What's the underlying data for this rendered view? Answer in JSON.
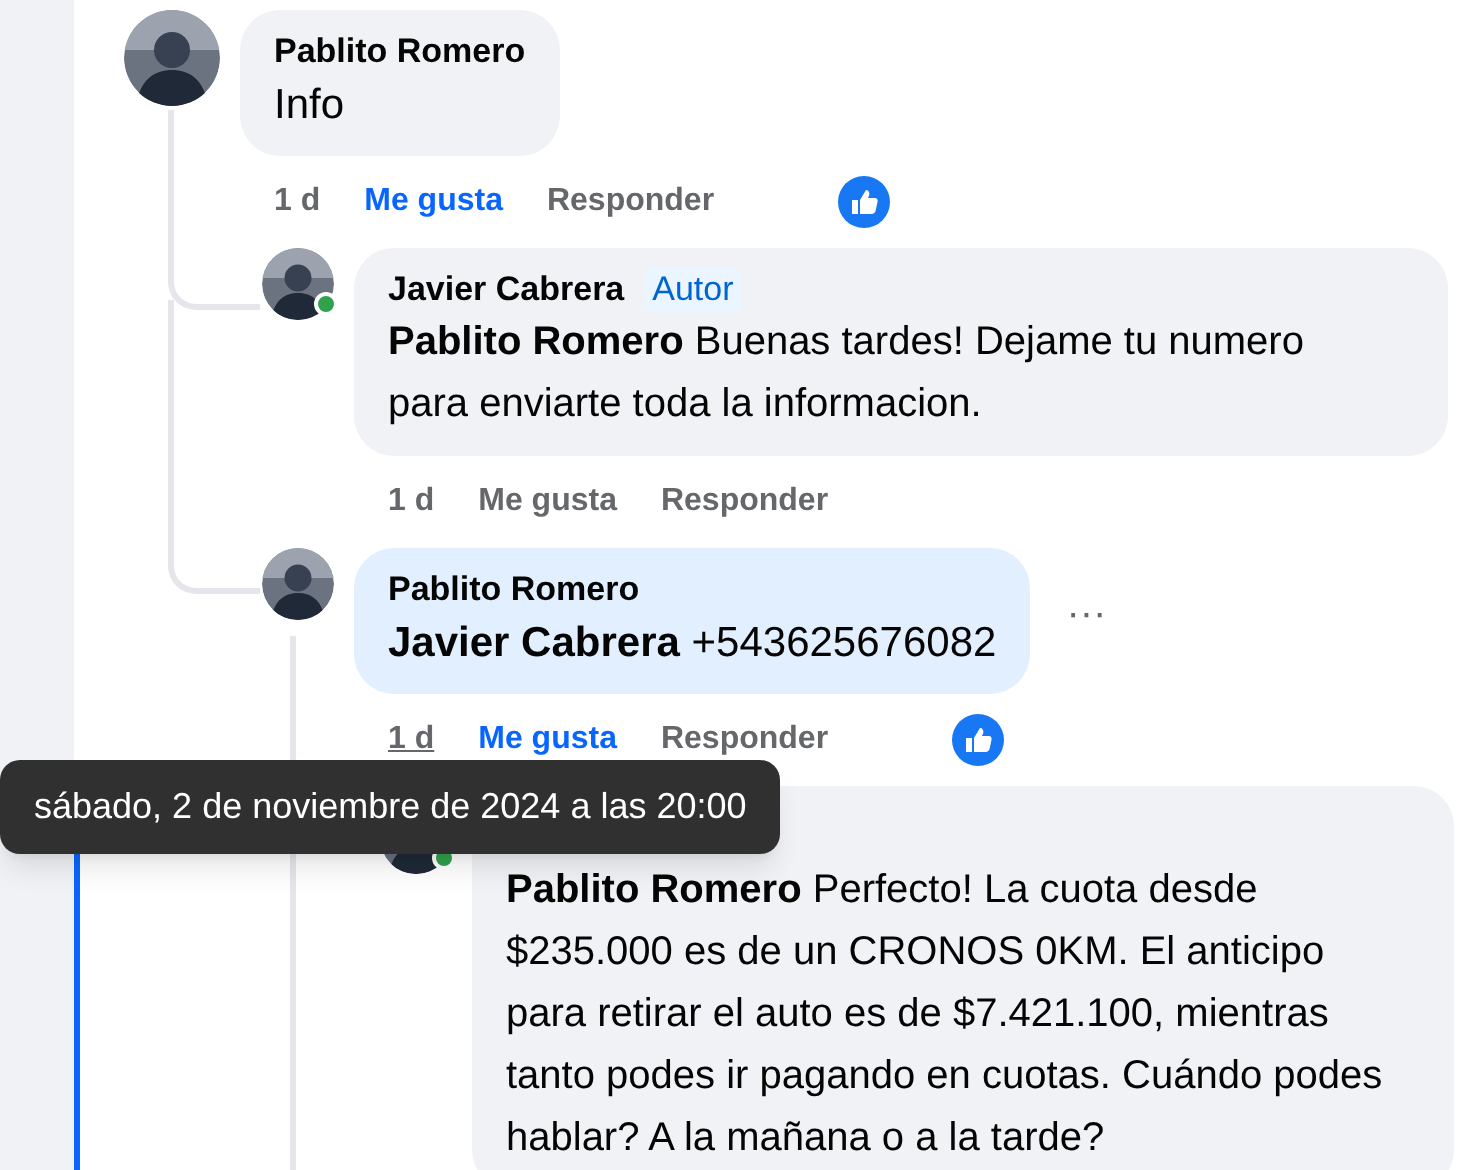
{
  "comments": [
    {
      "author": "Pablito Romero",
      "text": "Info",
      "highlighted": false,
      "online": false,
      "time": "1 d",
      "time_hovered": false,
      "like_label": "Me gusta",
      "liked": true,
      "reply_label": "Responder",
      "reaction": true,
      "replies": [
        {
          "author": "Javier Cabrera",
          "badge": "Autor",
          "text": "**Pablito Romero** Buenas tardes! Dejame tu numero para enviarte toda la informacion.",
          "highlighted": false,
          "online": true,
          "time": "1 d",
          "time_hovered": false,
          "like_label": "Me gusta",
          "liked": false,
          "reply_label": "Responder",
          "reaction": false
        },
        {
          "author": "Pablito Romero",
          "text": "**Javier Cabrera** +543625676082",
          "highlighted": true,
          "online": false,
          "more_label": "···",
          "time": "1 d",
          "time_hovered": true,
          "like_label": "Me gusta",
          "liked": true,
          "reply_label": "Responder",
          "reaction": true,
          "replies": [
            {
              "text": "**Pablito Romero** Perfecto! La cuota desde $235.000 es de un CRONOS 0KM. El anticipo para retirar el auto es de $7.421.100, mientras tanto podes ir pagando en cuotas. Cuándo podes hablar? A la mañana o a la tarde?",
              "highlighted": false,
              "online": true
            }
          ]
        }
      ]
    }
  ],
  "tooltip": {
    "text": "sábado, 2 de noviembre de 2024 a las 20:00"
  }
}
